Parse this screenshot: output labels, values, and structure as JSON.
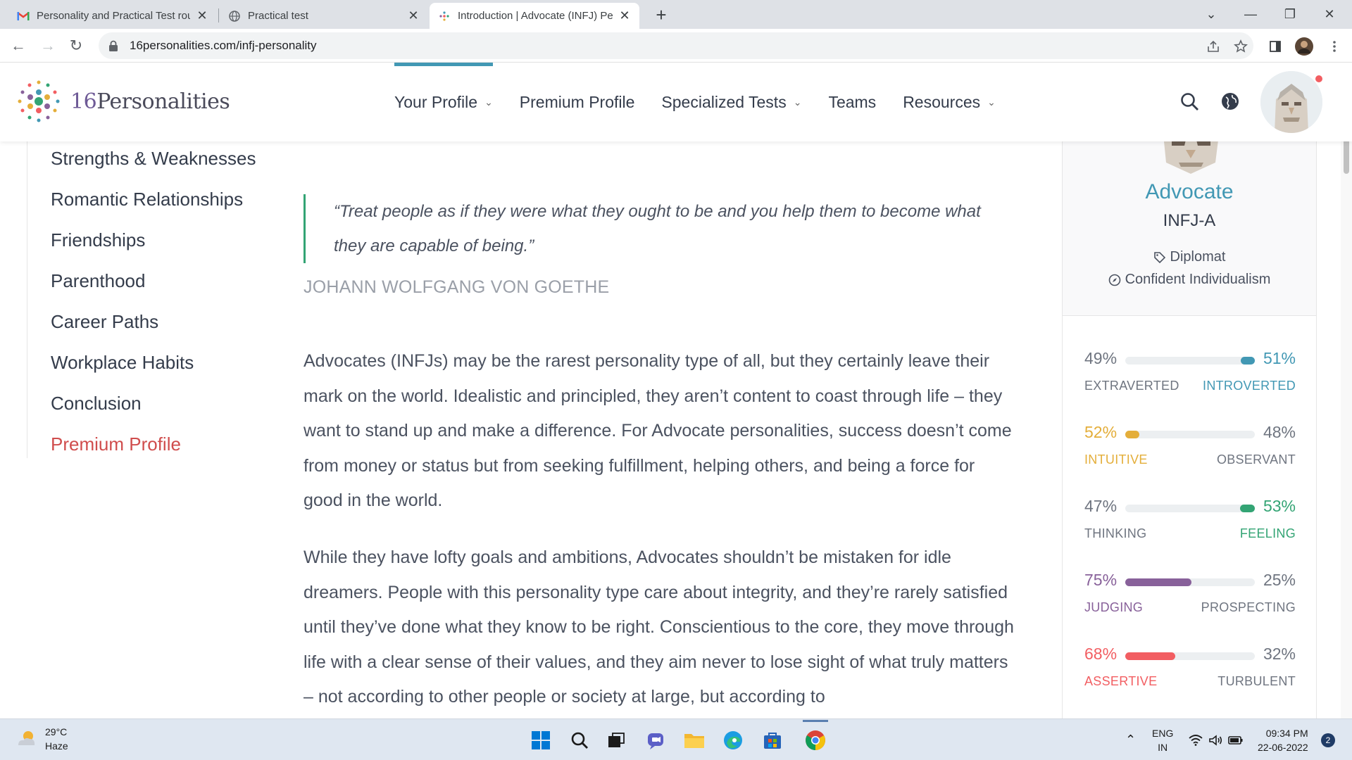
{
  "browser": {
    "tabs": [
      {
        "title": "Personality and Practical Test rou",
        "icon": "gmail-icon"
      },
      {
        "title": "Practical test",
        "icon": "globe-icon"
      },
      {
        "title": "Introduction | Advocate (INFJ) Pe",
        "icon": "16p-favicon",
        "active": true
      }
    ],
    "url": "16personalities.com/infj-personality"
  },
  "site": {
    "logo": {
      "number": "16",
      "word": "Personalities"
    },
    "nav": [
      {
        "label": "Your Profile",
        "has_dropdown": true,
        "active": true
      },
      {
        "label": "Premium Profile",
        "has_dropdown": false
      },
      {
        "label": "Specialized Tests",
        "has_dropdown": true
      },
      {
        "label": "Teams",
        "has_dropdown": false
      },
      {
        "label": "Resources",
        "has_dropdown": true
      }
    ]
  },
  "sidebar": {
    "items": [
      {
        "label": "Strengths & Weaknesses"
      },
      {
        "label": "Romantic Relationships"
      },
      {
        "label": "Friendships"
      },
      {
        "label": "Parenthood"
      },
      {
        "label": "Career Paths"
      },
      {
        "label": "Workplace Habits"
      },
      {
        "label": "Conclusion"
      },
      {
        "label": "Premium Profile",
        "highlight": true
      }
    ]
  },
  "main": {
    "quote_line1": "“Treat people as if they were what they ought to be and you help them to become what",
    "quote_line2": "they are capable of being.”",
    "quote_author": "JOHANN WOLFGANG VON GOETHE",
    "para1": "Advocates (INFJs) may be the rarest personality type of all, but they certainly leave their mark on the world. Idealistic and principled, they aren’t content to coast through life – they want to stand up and make a difference. For Advocate personalities, success doesn’t come from money or status but from seeking fulfillment, helping others, and being a force for good in the world.",
    "para2": "While they have lofty goals and ambitions, Advocates shouldn’t be mistaken for idle dreamers. People with this personality type care about integrity, and they’re rarely satisfied until they’ve done what they know to be right. Conscientious to the core, they move through life with a clear sense of their values, and they aim never to lose sight of what truly matters – not according to other people or society at large, but according to"
  },
  "profile_card": {
    "type_name": "Advocate",
    "type_code": "INFJ-A",
    "role": "Diplomat",
    "strategy": "Confident Individualism",
    "traits": [
      {
        "left_pct": "49%",
        "right_pct": "51%",
        "left_label": "EXTRAVERTED",
        "right_label": "INTROVERTED",
        "dominant": "right",
        "value": 0.51,
        "color": "#4298b4"
      },
      {
        "left_pct": "52%",
        "right_pct": "48%",
        "left_label": "INTUITIVE",
        "right_label": "OBSERVANT",
        "dominant": "left",
        "value": 0.52,
        "color": "#e4ae3a"
      },
      {
        "left_pct": "47%",
        "right_pct": "53%",
        "left_label": "THINKING",
        "right_label": "FEELING",
        "dominant": "right",
        "value": 0.53,
        "color": "#33a474"
      },
      {
        "left_pct": "75%",
        "right_pct": "25%",
        "left_label": "JUDGING",
        "right_label": "PROSPECTING",
        "dominant": "left",
        "value": 0.75,
        "color": "#88619a"
      },
      {
        "left_pct": "68%",
        "right_pct": "32%",
        "left_label": "ASSERTIVE",
        "right_label": "TURBULENT",
        "dominant": "left",
        "value": 0.68,
        "color": "#f25e62"
      }
    ]
  },
  "taskbar": {
    "weather_temp": "29°C",
    "weather_desc": "Haze",
    "lang_top": "ENG",
    "lang_bottom": "IN",
    "time": "09:34 PM",
    "date": "22-06-2022",
    "notification_count": "2"
  }
}
